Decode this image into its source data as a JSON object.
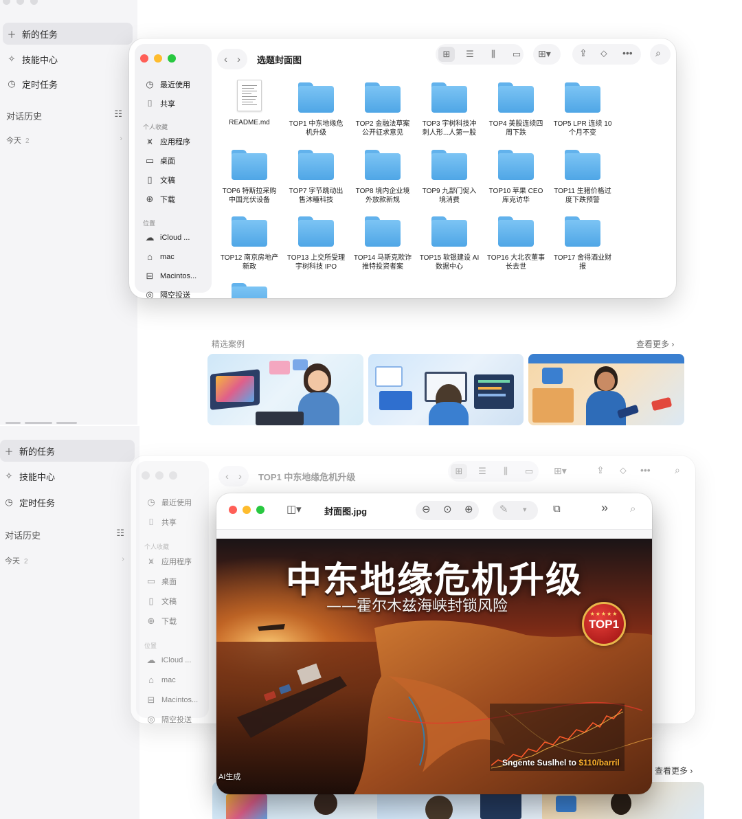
{
  "app_sidebar": {
    "new_task": "新的任务",
    "skills": "技能中心",
    "scheduled": "定时任务",
    "history": "对话历史",
    "today": "今天",
    "today_count": "2"
  },
  "finder": {
    "title_top": "选题封面图",
    "title_bottom": "TOP1 中东地缘危机升级",
    "sidebar": {
      "recents": "最近使用",
      "shared": "共享",
      "favorites_head": "个人收藏",
      "applications": "应用程序",
      "desktop": "桌面",
      "documents": "文稿",
      "downloads": "下载",
      "locations_head": "位置",
      "icloud": "iCloud ...",
      "mac": "mac",
      "macintosh": "Macintos...",
      "airdrop": "隔空投送"
    },
    "files": [
      {
        "l1": "README.md",
        "l2": ""
      },
      {
        "l1": "TOP1 中东地缘危",
        "l2": "机升级"
      },
      {
        "l1": "TOP2 金融法草案",
        "l2": "公开征求意见"
      },
      {
        "l1": "TOP3 宇树科技冲",
        "l2": "刺人形...人第一股"
      },
      {
        "l1": "TOP4 美股连续四",
        "l2": "周下跌"
      },
      {
        "l1": "TOP5 LPR 连续 10",
        "l2": "个月不变"
      },
      {
        "l1": "TOP6 特斯拉采购",
        "l2": "中国光伏设备"
      },
      {
        "l1": "TOP7 字节跳动出",
        "l2": "售沐瞳科技"
      },
      {
        "l1": "TOP8 境内企业境",
        "l2": "外放款新规"
      },
      {
        "l1": "TOP9 九部门促入",
        "l2": "境消费"
      },
      {
        "l1": "TOP10 苹果 CEO",
        "l2": "库克访华"
      },
      {
        "l1": "TOP11 生猪价格过",
        "l2": "度下跌预警"
      },
      {
        "l1": "TOP12 南京房地产",
        "l2": "新政"
      },
      {
        "l1": "TOP13 上交所受理",
        "l2": "宇树科技 IPO"
      },
      {
        "l1": "TOP14 马斯克欺诈",
        "l2": "推特投资者案"
      },
      {
        "l1": "TOP15 软银建设 AI",
        "l2": "数据中心"
      },
      {
        "l1": "TOP16 大北农董事",
        "l2": "长去世"
      },
      {
        "l1": "TOP17 舍得酒业财",
        "l2": "报"
      }
    ]
  },
  "featured": {
    "title": "精选案例",
    "more": "查看更多 ›"
  },
  "preview": {
    "filename": "封面图.jpg",
    "poster_title": "中东地缘危机升级",
    "poster_subtitle": "——霍尔木兹海峡封锁风险",
    "badge_stars": "★★★★★",
    "badge_text": "TOP1",
    "caption_prefix": "Sngente Suslhel to",
    "caption_price": "$110/barril",
    "ai_tag": "AI生成"
  },
  "colors": {
    "folder_blue": "#62b2ec",
    "close_red": "#ff5f57",
    "minimize_yellow": "#febc2e",
    "zoom_green": "#28c840"
  }
}
